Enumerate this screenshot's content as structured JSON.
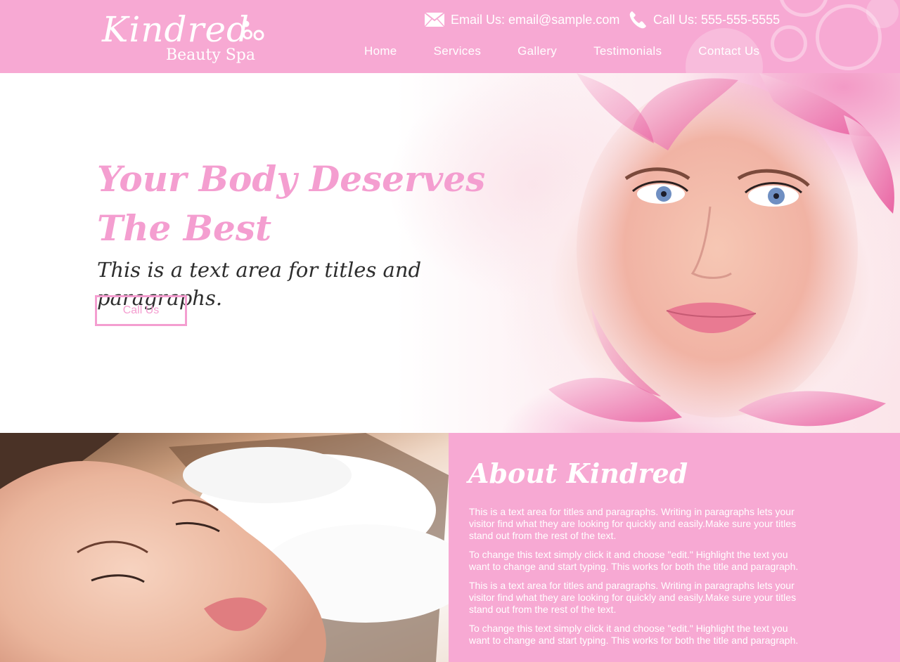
{
  "brand": {
    "logo_script": "Kindred",
    "logo_sub": "Beauty Spa",
    "colors": {
      "pink": "#f7a9d3",
      "accent_pink": "#f49ed0",
      "white": "#ffffff",
      "dark_text": "#2d2d2d"
    }
  },
  "header": {
    "email_icon": "envelope-icon",
    "email_text": "Email Us: email@sample.com",
    "phone_icon": "phone-icon",
    "phone_text": "Call Us: 555-555-5555",
    "nav": [
      "Home",
      "Services",
      "Gallery",
      "Testimonials",
      "Contact Us"
    ]
  },
  "hero": {
    "title_line1": "Your Body Deserves",
    "title_line2": "The Best",
    "subtitle": "This is a text area for titles and paragraphs.",
    "button_label": "Call Us"
  },
  "about": {
    "title": "About Kindred",
    "paragraphs": [
      "This is a text area for titles and paragraphs. Writing in paragraphs lets your visitor find what they are looking for quickly and easily.Make sure your titles stand out from the rest of the text.",
      "To change this text simply click it and choose \"edit.\" Highlight the text you want to change and start typing. This works for both the title and paragraph.",
      "This is a text area for titles and paragraphs. Writing in paragraphs lets your visitor find what they are looking for quickly and easily.Make sure your titles stand out from the rest of the text.",
      "To change this text simply click it and choose \"edit.\" Highlight the text you want to change and start typing. This works for both the title and paragraph."
    ]
  }
}
